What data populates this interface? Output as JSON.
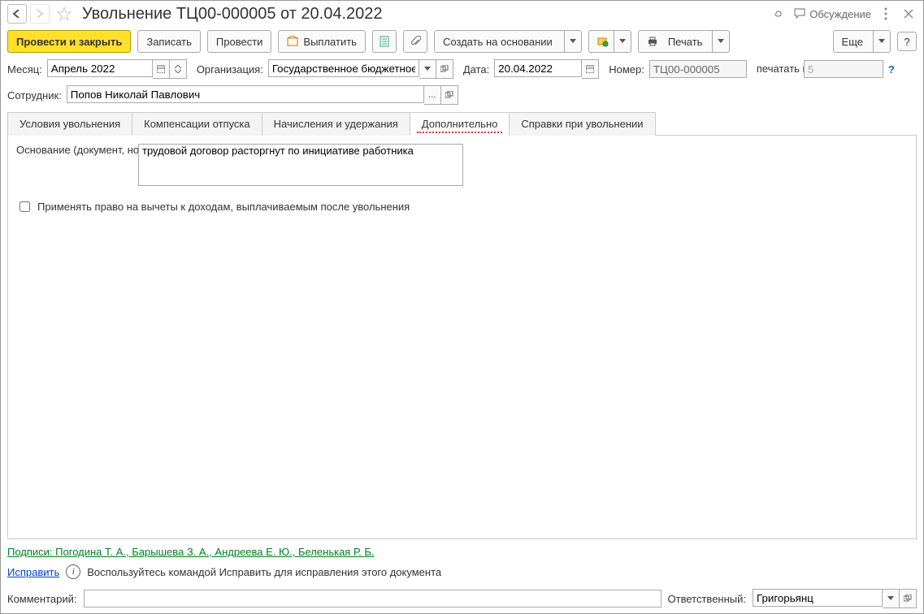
{
  "title": "Увольнение ТЦ00-000005 от 20.04.2022",
  "toolbar": {
    "post_close": "Провести и закрыть",
    "write": "Записать",
    "post": "Провести",
    "pay": "Выплатить",
    "create_based": "Создать на основании",
    "print": "Печать",
    "more": "Еще"
  },
  "discuss": "Обсуждение",
  "row1": {
    "month_label": "Месяц:",
    "month_value": "Апрель 2022",
    "org_label": "Организация:",
    "org_value": "Государственное бюджетное",
    "date_label": "Дата:",
    "date_value": "20.04.2022",
    "number_label": "Номер:",
    "number_value": "ТЦ00-000005",
    "print_as_label": "печатать как:",
    "print_as_value": "5"
  },
  "row2": {
    "emp_label": "Сотрудник:",
    "emp_value": "Попов Николай Павлович"
  },
  "tabs": [
    "Условия увольнения",
    "Компенсации отпуска",
    "Начисления и удержания",
    "Дополнительно",
    "Справки при увольнении"
  ],
  "extra": {
    "basis_label": "Основание (документ, номер, дата):",
    "basis_value": "трудовой договор расторгнут по инициативе работника",
    "deduction_label": "Применять право на вычеты к доходам, выплачиваемым после увольнения"
  },
  "signatures": "Подписи: Погодина Т. А., Барышева З. А., Андреева Е. Ю., Беленькая Р. Б.",
  "fix": {
    "link": "Исправить",
    "text": "Воспользуйтесь командой Исправить для исправления этого документа"
  },
  "bottom": {
    "comment_label": "Комментарий:",
    "comment_value": "",
    "resp_label": "Ответственный:",
    "resp_value": "Григорьянц"
  }
}
